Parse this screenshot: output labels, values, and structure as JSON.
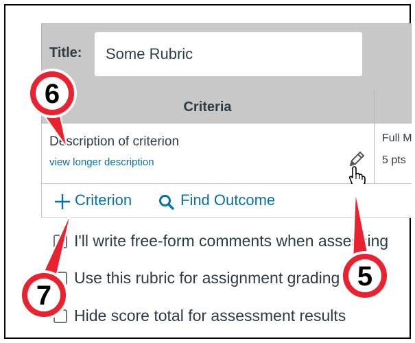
{
  "rubric": {
    "title_label": "Title:",
    "title_value": "Some Rubric",
    "criteria_header": "Criteria",
    "criterion": {
      "description": "Description of criterion",
      "longer_link": "view longer description",
      "rating_name": "Full M",
      "rating_points": "5 pts"
    },
    "actions": {
      "add_criterion": "Criterion",
      "find_outcome": "Find Outcome"
    },
    "options": [
      "I'll write free-form comments when assessing",
      "Use this rubric for assignment grading",
      "Hide score total for assessment results"
    ]
  },
  "callouts": [
    "6",
    "5",
    "7"
  ],
  "icons": {
    "plus": "plus-icon",
    "search": "search-icon",
    "pencil": "pencil-icon",
    "cursor": "hand-cursor-icon"
  },
  "colors": {
    "link": "#0770a3",
    "callout_fill": "#e8222e",
    "header_bg": "#c8c8c8",
    "text": "#2d3b45"
  }
}
